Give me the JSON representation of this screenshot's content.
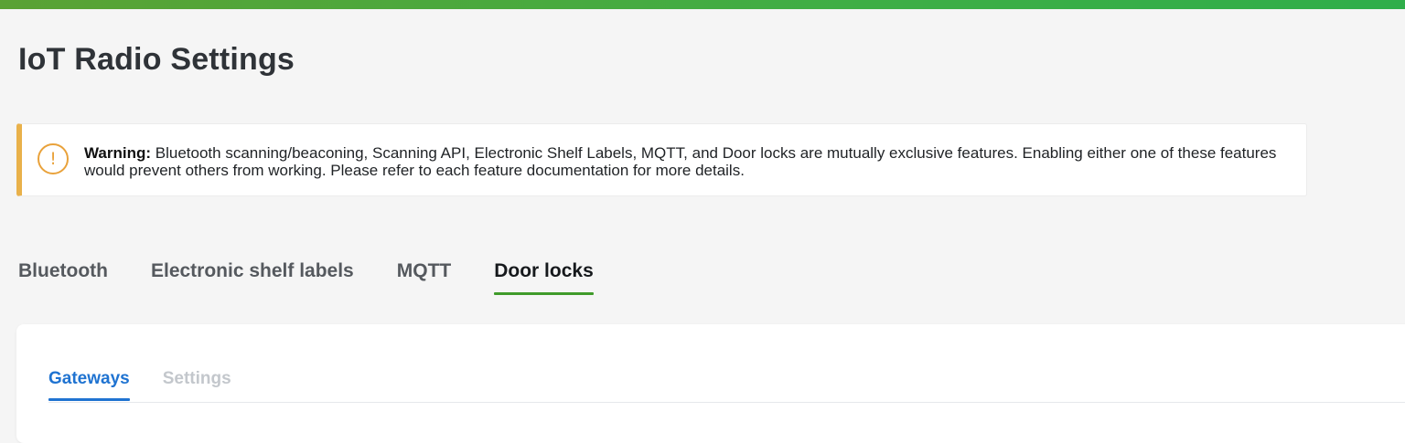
{
  "header": {
    "title": "IoT Radio Settings",
    "accent_color": "#3fae45"
  },
  "warning": {
    "icon": "exclamation-circle-icon",
    "icon_glyph": "!",
    "label": "Warning:",
    "message": "Bluetooth scanning/beaconing, Scanning API, Electronic Shelf Labels, MQTT, and Door locks are mutually exclusive features. Enabling either one of these features would prevent others from working. Please refer to each feature documentation for more details.",
    "border_color": "#e9b14a"
  },
  "main_tabs": {
    "items": [
      {
        "label": "Bluetooth"
      },
      {
        "label": "Electronic shelf labels"
      },
      {
        "label": "MQTT"
      },
      {
        "label": "Door locks"
      }
    ],
    "active": "Door locks",
    "active_color": "#3f9b2a"
  },
  "sub_tabs": {
    "items": [
      {
        "label": "Gateways"
      },
      {
        "label": "Settings"
      }
    ],
    "active": "Gateways",
    "active_color": "#1f73d1"
  }
}
